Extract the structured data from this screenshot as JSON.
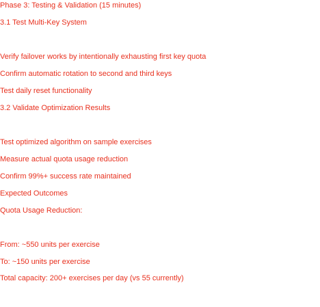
{
  "theme": {
    "text_color": "#e8301e",
    "background": "#ffffff"
  },
  "document": {
    "phase_heading": "Phase 3: Testing & Validation (15 minutes)",
    "section_1": {
      "heading": "3.1 Test Multi-Key System",
      "items": [
        "Verify failover works by intentionally exhausting first key quota",
        "Confirm automatic rotation to second and third keys",
        "Test daily reset functionality"
      ]
    },
    "section_2": {
      "heading": "3.2 Validate Optimization Results",
      "items": [
        "Test optimized algorithm on sample exercises",
        "Measure actual quota usage reduction",
        "Confirm 99%+ success rate maintained"
      ]
    },
    "outcomes": {
      "heading": "Expected Outcomes",
      "subheading": "Quota Usage Reduction:",
      "items": [
        "From: ~550 units per exercise",
        "To: ~150 units per exercise",
        "Total capacity: 200+ exercises per day (vs 55 currently)"
      ]
    }
  }
}
